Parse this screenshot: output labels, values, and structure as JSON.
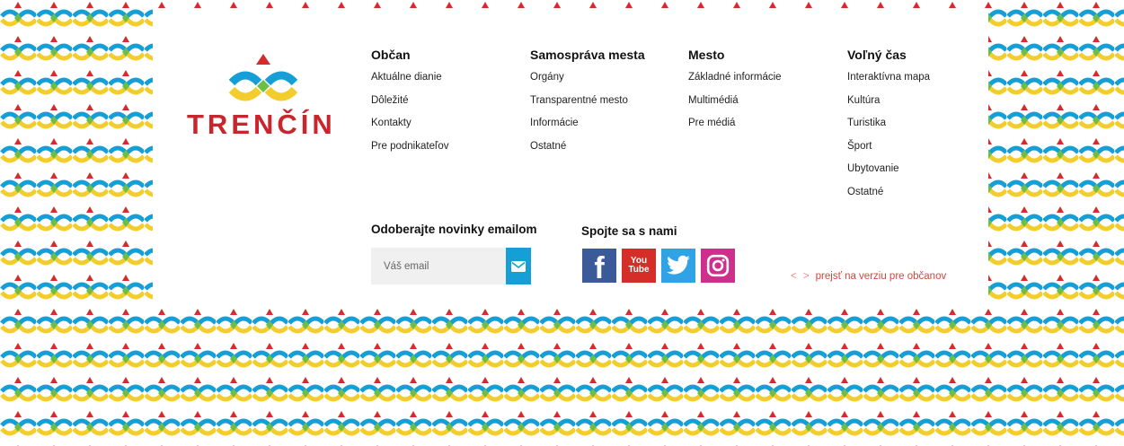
{
  "brand": {
    "name": "TRENČÍN",
    "accent": "#c8262c"
  },
  "colors": {
    "blue": "#159fd6",
    "yellow": "#f3cd2b",
    "green": "#6cbe45",
    "red": "#d62b2b"
  },
  "columns": [
    {
      "title": "Občan",
      "links": [
        "Aktuálne dianie",
        "Dôležité",
        "Kontakty",
        "Pre podnikateľov"
      ]
    },
    {
      "title": "Samospráva mesta",
      "links": [
        "Orgány",
        "Transparentné mesto",
        "Informácie",
        "Ostatné"
      ]
    },
    {
      "title": "Mesto",
      "links": [
        "Základné informácie",
        "Multimédiá",
        "Pre médiá"
      ]
    },
    {
      "title": "Voľný čas",
      "links": [
        "Interaktívna mapa",
        "Kultúra",
        "Turistika",
        "Šport",
        "Ubytovanie",
        "Ostatné"
      ]
    }
  ],
  "newsletter": {
    "title": "Odoberajte novinky emailom",
    "placeholder": "Váš email",
    "icon": "envelope-icon"
  },
  "social": {
    "title": "Spojte sa s nami",
    "items": [
      {
        "name": "facebook-icon",
        "text": "f"
      },
      {
        "name": "youtube-icon",
        "text": "You Tube"
      },
      {
        "name": "twitter-icon"
      },
      {
        "name": "instagram-icon"
      }
    ]
  },
  "switch_link": {
    "chevrons": "< >",
    "text": "prejsť na verziu pre občanov"
  }
}
